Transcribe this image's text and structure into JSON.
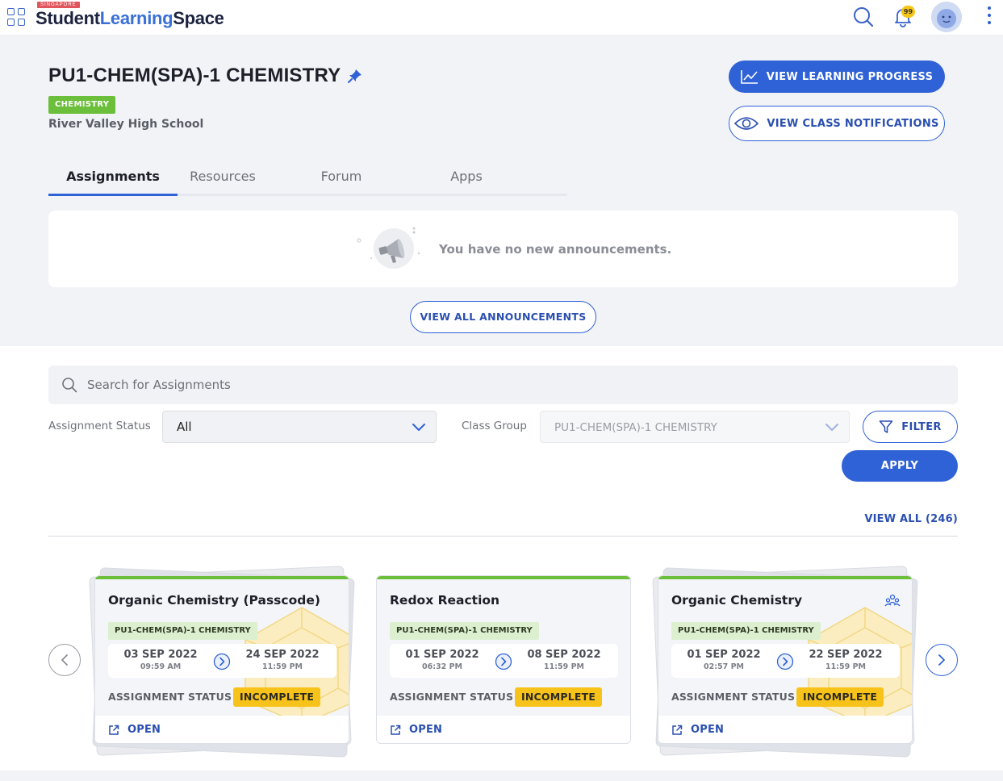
{
  "app": {
    "logo_tag": "SINGAPORE",
    "logo_word1": "Student",
    "logo_word2": "Learning",
    "logo_word3": "Space",
    "notification_count": "99"
  },
  "course": {
    "title": "PU1-CHEM(SPA)-1 CHEMISTRY",
    "subject": "CHEMISTRY",
    "school": "River Valley High School",
    "subject_color": "#6bbf3a"
  },
  "actions": {
    "progress_label": "VIEW LEARNING PROGRESS",
    "notifications_label": "VIEW CLASS NOTIFICATIONS"
  },
  "tabs": [
    {
      "label": "Assignments",
      "active": true
    },
    {
      "label": "Resources",
      "active": false
    },
    {
      "label": "Forum",
      "active": false
    },
    {
      "label": "Apps",
      "active": false
    }
  ],
  "announcements": {
    "empty_text": "You have no new announcements.",
    "view_all_label": "VIEW ALL ANNOUNCEMENTS"
  },
  "filters": {
    "search_placeholder": "Search for Assignments",
    "status_label": "Assignment Status",
    "status_value": "All",
    "group_label": "Class Group",
    "group_value": "PU1-CHEM(SPA)-1 CHEMISTRY",
    "filter_label": "FILTER",
    "apply_label": "APPLY",
    "view_all_label": "VIEW ALL (246)"
  },
  "assignments": [
    {
      "title": "Organic Chemistry (Passcode)",
      "tag": "PU1-CHEM(SPA)-1 CHEMISTRY",
      "start_date": "03 SEP 2022",
      "start_time": "09:59 AM",
      "end_date": "24 SEP 2022",
      "end_time": "11:59 PM",
      "status_label": "ASSIGNMENT STATUS",
      "status": "INCOMPLETE",
      "open_label": "OPEN",
      "stacked": true,
      "group_icon": false
    },
    {
      "title": "Redox Reaction",
      "tag": "PU1-CHEM(SPA)-1 CHEMISTRY",
      "start_date": "01 SEP 2022",
      "start_time": "06:32 PM",
      "end_date": "08 SEP 2022",
      "end_time": "11:59 PM",
      "status_label": "ASSIGNMENT STATUS",
      "status": "INCOMPLETE",
      "open_label": "OPEN",
      "stacked": false,
      "group_icon": false
    },
    {
      "title": "Organic Chemistry",
      "tag": "PU1-CHEM(SPA)-1 CHEMISTRY",
      "start_date": "01 SEP 2022",
      "start_time": "02:57 PM",
      "end_date": "22 SEP 2022",
      "end_time": "11:59 PM",
      "status_label": "ASSIGNMENT STATUS",
      "status": "INCOMPLETE",
      "open_label": "OPEN",
      "stacked": true,
      "group_icon": true
    }
  ],
  "colors": {
    "primary": "#2f62d6",
    "status_incomplete": "#f7c31a",
    "hero_bg": "#f1f3f7"
  }
}
